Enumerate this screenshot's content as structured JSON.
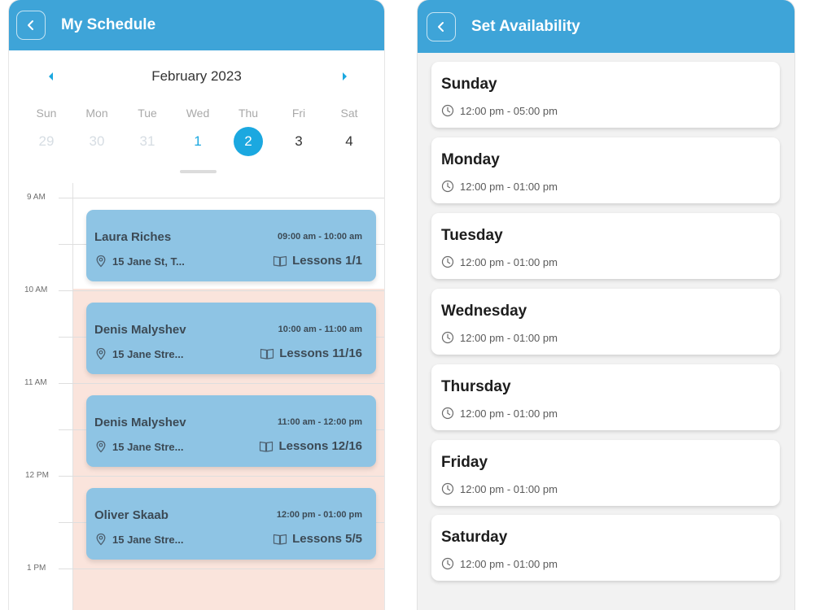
{
  "schedule": {
    "title": "My Schedule",
    "month": "February 2023",
    "weekdays": [
      "Sun",
      "Mon",
      "Tue",
      "Wed",
      "Thu",
      "Fri",
      "Sat"
    ],
    "dates": [
      "29",
      "30",
      "31",
      "1",
      "2",
      "3",
      "4"
    ],
    "selected_date": "2",
    "hours": [
      "9 AM",
      "10 AM",
      "11 AM",
      "12 PM",
      "1 PM"
    ],
    "lessons": [
      {
        "name": "Laura Riches",
        "time": "09:00 am - 10:00 am",
        "address": "15 Jane St, T...",
        "lessons": "Lessons 1/1"
      },
      {
        "name": "Denis Malyshev",
        "time": "10:00 am - 11:00 am",
        "address": "15 Jane Stre...",
        "lessons": "Lessons 11/16"
      },
      {
        "name": "Denis Malyshev",
        "time": "11:00 am - 12:00 pm",
        "address": "15 Jane Stre...",
        "lessons": "Lessons 12/16"
      },
      {
        "name": "Oliver Skaab",
        "time": "12:00 pm - 01:00 pm",
        "address": "15 Jane Stre...",
        "lessons": "Lessons 5/5"
      }
    ],
    "colors": {
      "header": "#3ea4d8",
      "accent": "#1ba8e0",
      "card": "#8ec4e4",
      "shade": "#fae4dc"
    }
  },
  "availability": {
    "title": "Set Availability",
    "days": [
      {
        "day": "Sunday",
        "time": "12:00 pm - 05:00 pm"
      },
      {
        "day": "Monday",
        "time": "12:00 pm - 01:00 pm"
      },
      {
        "day": "Tuesday",
        "time": "12:00 pm - 01:00 pm"
      },
      {
        "day": "Wednesday",
        "time": "12:00 pm - 01:00 pm"
      },
      {
        "day": "Thursday",
        "time": "12:00 pm - 01:00 pm"
      },
      {
        "day": "Friday",
        "time": "12:00 pm - 01:00 pm"
      },
      {
        "day": "Saturday",
        "time": "12:00 pm - 01:00 pm"
      }
    ]
  },
  "icons": {
    "back": "chevron-left-icon",
    "prev": "caret-left-icon",
    "next": "caret-right-icon",
    "location": "location-pin-icon",
    "book": "book-icon",
    "clock": "clock-icon"
  }
}
